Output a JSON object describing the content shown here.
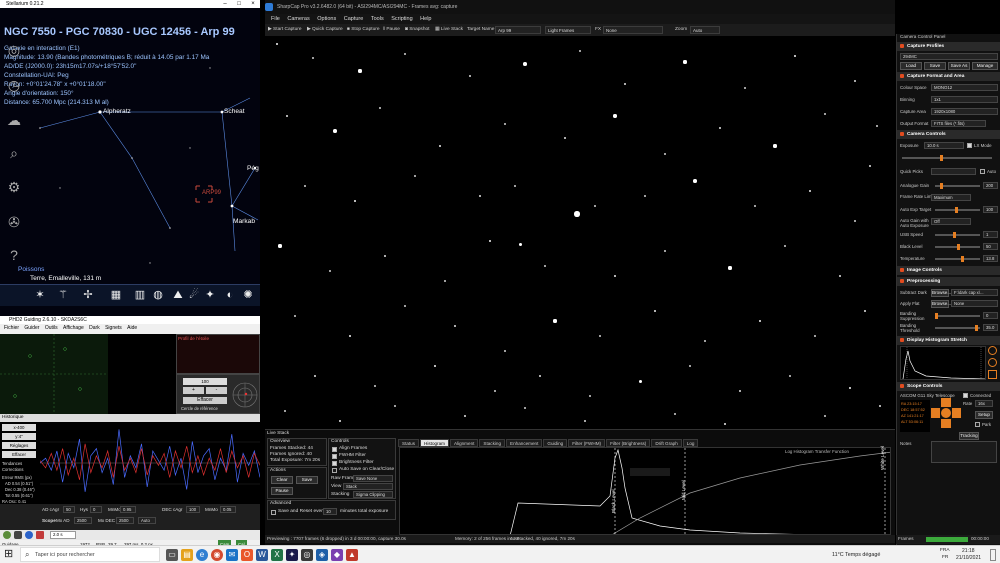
{
  "stellarium": {
    "title": "Stellarium 0.21.2",
    "object_name": "NGC 7550 - PGC 70830 - UGC 12456 - Arp 99",
    "info_lines": [
      "Galaxie en interaction (E1)",
      "Magnitude: 13.90 (Bandes photométriques B; réduit à 14.05 par 1.17 Ma",
      "AD/DE (J2000.0): 23h15m17.07s/+18°57'52.0\"",
      "Constellation-UAI: Peg",
      "Rayon: +0°01'24.78\" x +0°01'18.00\"",
      "Angle d'orientation: 150°",
      "Distance: 65.700 Mpc (214.313 M al)"
    ],
    "stars": [
      "Alpheratz",
      "Scheat",
      "Pég",
      "Markab"
    ],
    "object_marker": "ARP99",
    "constellation_label": "Poissons",
    "location": "Terre, Emalleville, 131 m",
    "bottom_icons": [
      "constellation-lines-icon",
      "constellation-art-icon",
      "grid-icon",
      "ground-icon",
      "nebula-icon",
      "planet-icon",
      "deep-sky-icon",
      "satellite-icon",
      "night-mode-icon"
    ]
  },
  "phd": {
    "title": "PHD2 Guiding 2.6.10 - SKDA2S6C",
    "menu": [
      "Fichier",
      "Guider",
      "Outils",
      "Affichage",
      "Dark",
      "Signets",
      "Aide"
    ],
    "stats_title": "Profil de l'étoile",
    "graph_label": "Historique",
    "x_label": "x-400",
    "y_label": "y:4\"",
    "sidebar_buttons": [
      "Réglages",
      "Effacer"
    ],
    "checkboxes": [
      "Tendances",
      "Corrections"
    ],
    "stats": [
      "Erreur RMS (px)",
      "AD 0.54 (0.51\")",
      "Dec 0.38 (0.46\")",
      "Tot 0.55 (0.61\")",
      "RA Osc: 0.41"
    ],
    "controls": {
      "ad_agr": "AD cAgr",
      "ad_agr_val": "50",
      "hys": "Hys",
      "hys_val": "0",
      "mn_mo": "MnMo",
      "mn_mo_val": "0.95",
      "dec_agr": "DEC cAgr",
      "dec_agr_val": "100",
      "dec_mnmo": "MnMo",
      "dec_mnmo_val": "0.05",
      "scope": "Scope",
      "mx_ad": "Mx AD",
      "mx_ad_val": "2500",
      "mx_dec": "Mx DEC",
      "mx_dec_val": "2500",
      "auto": "Auto"
    },
    "side_panel": {
      "zoom": "100",
      "plus": "+",
      "minus": "-",
      "effacer": "Effacer",
      "reference": "Cercle de référence"
    },
    "status": {
      "guiding": "Guidage",
      "exposure": "2.0 s",
      "pos": "1972",
      "snr": "RSB",
      "snr_val": "29.7",
      "ra": "297 ms, 0.2 px",
      "cam": "Cam",
      "cal": "Cal"
    }
  },
  "sharpcap": {
    "title": "SharpCap Pro v3.2.6482.0 (64 bit) - ASI294MC/ASI294MC - Frames avg: capture",
    "menu": [
      "File",
      "Cameras",
      "Options",
      "Capture",
      "Tools",
      "Scripting",
      "Help"
    ],
    "toolbar": {
      "start_capture": "Start Capture",
      "quick_capture": "Quick Capture",
      "stop_capture": "Stop Capture",
      "pause": "Pause",
      "snapshot": "Snapshot",
      "live_stack": "Live Stack",
      "target_name_label": "Target Name",
      "target_name": "Arp 99",
      "frames_type": "Light Frames",
      "fx_label": "FX",
      "fx_value": "None",
      "zoom_label": "Zoom",
      "zoom_value": "Auto"
    },
    "live_stack": {
      "title": "Live Stack",
      "overview": "Overview",
      "frames_stacked": "Frames Stacked: 44",
      "frames_ignored": "Frames Ignored: 40",
      "total_exposure": "Total Exposure: 7m 20s",
      "actions": "Actions",
      "clear": "Clear",
      "save": "Save",
      "pause": "Pause",
      "controls": "Controls",
      "align_frames": "Align Frames",
      "fwhm_filter": "FWHM Filter",
      "brightness_filter": "Brightness Filter",
      "auto_save": "Auto Save on Clear/Close",
      "raw_frames_label": "Raw Frames",
      "raw_frames": "Save None",
      "view_label": "View",
      "view": "Stack",
      "stacking_label": "Stacking",
      "stacking": "Sigma Clipping",
      "advanced": "Advanced",
      "save_reset": "Save and Reset every",
      "save_reset_val": "10",
      "minutes": "minutes total exposure",
      "tabs": [
        "Status",
        "Histogram",
        "Alignment",
        "Stacking",
        "Enhancement",
        "Guiding",
        "Filter (FWHM)",
        "Filter (Brightness)",
        "Drift Graph",
        "Log"
      ],
      "selected_tab": "Histogram",
      "black_level_label": "Black Level",
      "mid_level_label": "Mid Level",
      "white_label": "White Level",
      "legend": "Log Histogram   Transfer Function"
    },
    "status_bar": {
      "previewing": "Previewing : 7707 frames (6 dropped) in 3 d 00:00:00, capture 30.0s",
      "memory": "Memory: 2 of 256 frames in use",
      "stacked": "44 Stacked, 40 ignored, 7m 20s"
    }
  },
  "camera_panel": {
    "title": "Camera Control Panel",
    "capture_profiles": "Capture Profiles",
    "profile": "294MC",
    "load": "Load",
    "save": "Save",
    "save_as": "Save As",
    "manage": "Manage",
    "capture_format": "Capture Format and Area",
    "colour_space_label": "Colour Space",
    "colour_space": "MONO12",
    "binning_label": "Binning",
    "binning": "1x1",
    "capture_area_label": "Capture Area",
    "capture_area": "1920x1080",
    "output_format_label": "Output Format",
    "output_format": "FITS files (*.fits)",
    "camera_controls": "Camera Controls",
    "exposure_label": "Exposure",
    "exposure": "10.0 s",
    "lx_mode": "LX Mode",
    "quick_picks": "Quick Picks",
    "auto": "Auto",
    "analogue_gain_label": "Analogue Gain",
    "analogue_gain": "200",
    "frame_rate_label": "Frame Rate Limit",
    "frame_rate": "Maximum",
    "auto_exp_label": "Auto Exp Target",
    "auto_exp": "100",
    "auto_gain_label": "Auto Gain with Auto Exposure",
    "auto_gain": "Off",
    "usb_label": "USB Speed",
    "usb": "1",
    "black_level_label": "Black Level",
    "black_level": "50",
    "temperature_label": "Temperature",
    "temperature": "13.8",
    "image_controls": "Image Controls",
    "preprocessing": "Preprocessing",
    "subtract_dark_label": "Subtract Dark",
    "browse": "Browse...",
    "subtract_dark": "F:\\dark cap x\\...",
    "apply_flat_label": "Apply Flat",
    "apply_flat": "None",
    "banding_label": "Banding Suppression",
    "banding_val": "0",
    "banding_threshold_label": "Banding Threshold",
    "banding_threshold_val": "35.0",
    "display_histogram": "Display Histogram Stretch",
    "scope_controls": "Scope Controls",
    "scope_name": "ASCOM G11 Sky Telescope",
    "connected": "Connected",
    "rate_label": "Rate",
    "rate": "16x",
    "setup": "Setup",
    "park": "Park",
    "tracking": "Tracking",
    "notes": "Notes",
    "frames_label": "Frames",
    "time": "00:00:00"
  },
  "taskbar": {
    "search": "Taper ici pour rechercher",
    "weather": "11°C  Temps dégagé",
    "lang": "FRA",
    "lang2": "FR",
    "clock": "21:18",
    "date": "21/10/2021"
  },
  "star_field": [
    [
      12,
      8,
      1.4
    ],
    [
      48,
      22,
      1.0
    ],
    [
      95,
      35,
      1.6
    ],
    [
      140,
      18,
      1.0
    ],
    [
      205,
      40,
      1.1
    ],
    [
      260,
      28,
      1.8
    ],
    [
      315,
      15,
      1.0
    ],
    [
      360,
      48,
      1.2
    ],
    [
      420,
      26,
      1.6
    ],
    [
      480,
      52,
      1.0
    ],
    [
      530,
      20,
      1.4
    ],
    [
      590,
      45,
      1.1
    ],
    [
      612,
      90,
      1.0
    ],
    [
      22,
      80,
      1.2
    ],
    [
      70,
      95,
      1.8
    ],
    [
      115,
      72,
      1.0
    ],
    [
      175,
      110,
      1.3
    ],
    [
      240,
      88,
      1.0
    ],
    [
      300,
      102,
      1.2
    ],
    [
      350,
      80,
      1.7
    ],
    [
      400,
      118,
      1.0
    ],
    [
      455,
      92,
      1.2
    ],
    [
      510,
      110,
      1.6
    ],
    [
      560,
      78,
      1.0
    ],
    [
      605,
      130,
      1.2
    ],
    [
      40,
      150,
      1.0
    ],
    [
      90,
      165,
      1.4
    ],
    [
      150,
      140,
      1.0
    ],
    [
      215,
      160,
      1.2
    ],
    [
      250,
      150,
      1.0
    ],
    [
      312,
      178,
      2.6
    ],
    [
      330,
      170,
      1.0
    ],
    [
      380,
      160,
      1.0
    ],
    [
      430,
      145,
      1.8
    ],
    [
      490,
      170,
      1.0
    ],
    [
      545,
      155,
      1.3
    ],
    [
      590,
      185,
      1.0
    ],
    [
      15,
      210,
      1.6
    ],
    [
      65,
      235,
      1.0
    ],
    [
      120,
      220,
      1.2
    ],
    [
      180,
      245,
      1.0
    ],
    [
      225,
      205,
      1.4
    ],
    [
      255,
      208,
      1.5
    ],
    [
      280,
      230,
      1.0
    ],
    [
      350,
      240,
      1.3
    ],
    [
      400,
      215,
      1.0
    ],
    [
      465,
      232,
      1.6
    ],
    [
      520,
      210,
      1.0
    ],
    [
      575,
      240,
      1.2
    ],
    [
      30,
      280,
      1.0
    ],
    [
      85,
      300,
      1.4
    ],
    [
      140,
      270,
      1.0
    ],
    [
      190,
      290,
      1.2
    ],
    [
      240,
      315,
      1.0
    ],
    [
      290,
      285,
      1.6
    ],
    [
      335,
      300,
      1.0
    ],
    [
      390,
      275,
      1.3
    ],
    [
      440,
      305,
      1.0
    ],
    [
      495,
      285,
      1.4
    ],
    [
      550,
      300,
      1.0
    ],
    [
      600,
      275,
      1.2
    ],
    [
      50,
      340,
      1.2
    ],
    [
      110,
      350,
      1.0
    ],
    [
      170,
      330,
      1.4
    ],
    [
      230,
      355,
      1.0
    ],
    [
      275,
      340,
      1.2
    ],
    [
      325,
      360,
      1.0
    ],
    [
      375,
      345,
      1.5
    ],
    [
      425,
      330,
      1.0
    ],
    [
      475,
      355,
      1.2
    ],
    [
      525,
      340,
      1.0
    ],
    [
      585,
      352,
      1.4
    ],
    [
      20,
      375,
      1.0
    ],
    [
      75,
      385,
      1.3
    ],
    [
      130,
      370,
      1.0
    ],
    [
      200,
      380,
      1.2
    ],
    [
      260,
      372,
      1.0
    ],
    [
      320,
      385,
      1.1
    ],
    [
      410,
      378,
      1.0
    ],
    [
      460,
      388,
      1.3
    ],
    [
      560,
      380,
      1.0
    ],
    [
      615,
      370,
      1.2
    ]
  ],
  "guide_trace_ra": [
    0,
    2,
    -3,
    5,
    -8,
    4,
    -2,
    10,
    -12,
    3,
    6,
    -4,
    2,
    -9,
    14,
    -6,
    3,
    -2,
    8,
    -10,
    5,
    1,
    -3,
    7,
    -5,
    2,
    -11,
    9,
    -4,
    3,
    6,
    -7,
    2,
    -3,
    12,
    -8,
    4,
    -1,
    5,
    -6
  ],
  "guide_trace_dec": [
    1,
    -2,
    4,
    -3,
    6,
    -5,
    2,
    -7,
    8,
    -4,
    3,
    -2,
    5,
    -6,
    7,
    -3,
    2,
    -4,
    6,
    -5,
    3,
    -1,
    4,
    -6,
    5,
    -2,
    7,
    -4,
    3,
    -5,
    2,
    -3,
    6,
    -4,
    5,
    -2,
    3,
    -6,
    4,
    -1
  ]
}
